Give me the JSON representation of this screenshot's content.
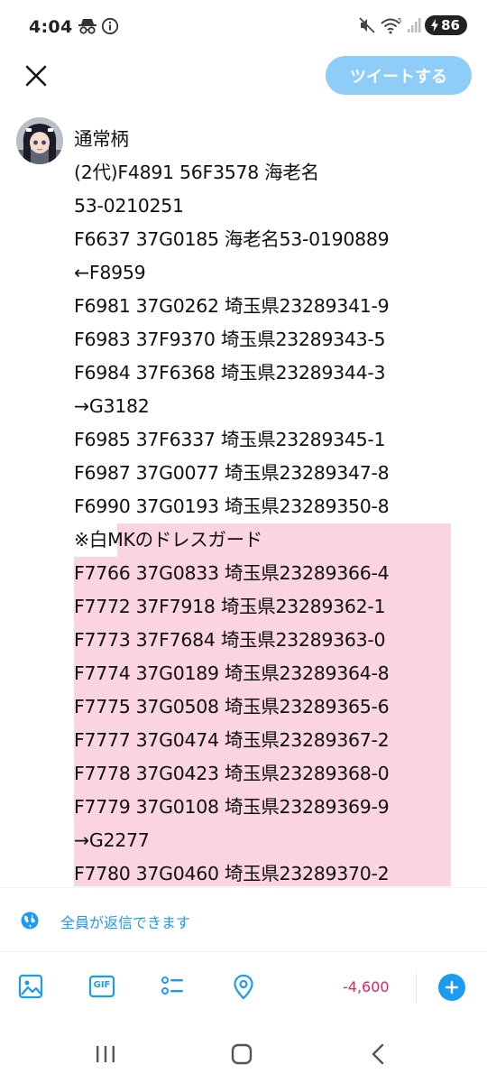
{
  "status_bar": {
    "time": "4:04",
    "battery": "86"
  },
  "header": {
    "tweet_button_label": "ツイートする"
  },
  "tweet": {
    "lines": [
      "通常柄",
      "(2代)F4891 56F3578 海老名",
      "53-0210251",
      "F6637 37G0185 海老名53-0190889",
      "←F8959",
      "F6981 37G0262 埼玉県23289341-9",
      "F6983 37F9370 埼玉県23289343-5",
      "F6984 37F6368 埼玉県23289344-3",
      "→G3182",
      "F6985 37F6337 埼玉県23289345-1",
      "F6987 37G0077 埼玉県23289347-8",
      "F6990 37G0193 埼玉県23289350-8",
      "※白MKのドレスガード",
      "F7766 37G0833 埼玉県23289366-4",
      "F7772 37F7918 埼玉県23289362-1",
      "F7773 37F7684 埼玉県23289363-0",
      "F7774 37G0189 埼玉県23289364-8",
      "F7775 37G0508 埼玉県23289365-6",
      "F7777 37G0474 埼玉県23289367-2",
      "F7778 37G0423 埼玉県23289368-0",
      "F7779 37G0108 埼玉県23289369-9",
      "→G2277",
      "F7780 37G0460 埼玉県23289370-2"
    ]
  },
  "reply_setting": {
    "label": "全員が返信できます"
  },
  "toolbar": {
    "gif_label": "GIF",
    "char_count": "-4,600"
  },
  "colors": {
    "accent": "#1d9bf0",
    "tweet_button_disabled": "#8ecdf8",
    "highlight": "#fad4e0",
    "over_limit": "#e0245e"
  }
}
